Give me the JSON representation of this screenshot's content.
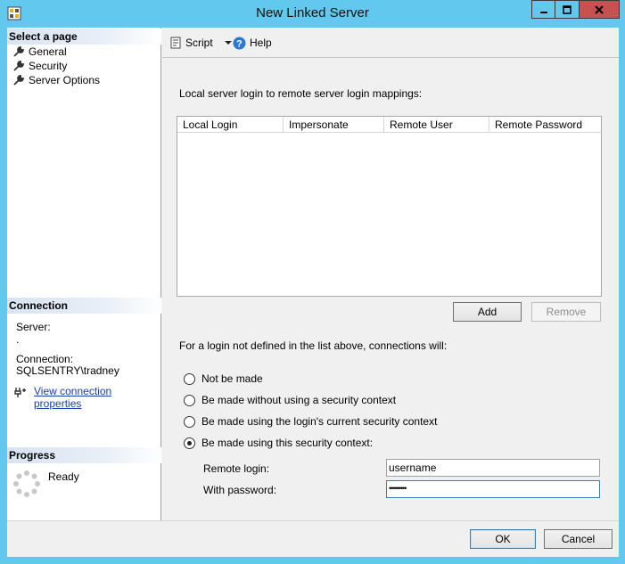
{
  "window": {
    "title": "New Linked Server"
  },
  "left": {
    "select_page_header": "Select a page",
    "pages": [
      {
        "label": "General"
      },
      {
        "label": "Security"
      },
      {
        "label": "Server Options"
      }
    ],
    "connection_header": "Connection",
    "server_label": "Server:",
    "server_value": ".",
    "connection_label": "Connection:",
    "connection_value": "SQLSENTRY\\tradney",
    "view_props_link": "View connection properties",
    "progress_header": "Progress",
    "progress_status": "Ready"
  },
  "toolbar": {
    "script_label": "Script",
    "help_label": "Help"
  },
  "main": {
    "mappings_caption": "Local server login to remote server login mappings:",
    "columns": [
      "Local Login",
      "Impersonate",
      "Remote User",
      "Remote Password"
    ],
    "add_label": "Add",
    "remove_label": "Remove",
    "undefined_caption": "For a login not defined in the list above, connections will:",
    "options": [
      {
        "label": "Not be made",
        "checked": false
      },
      {
        "label": "Be made without using a security context",
        "checked": false
      },
      {
        "label": "Be made using the login's current security context",
        "checked": false
      },
      {
        "label": "Be made using this security context:",
        "checked": true
      }
    ],
    "remote_login_label": "Remote login:",
    "remote_login_value": "username",
    "password_label": "With password:",
    "password_value": "•••••••••"
  },
  "footer": {
    "ok_label": "OK",
    "cancel_label": "Cancel"
  }
}
